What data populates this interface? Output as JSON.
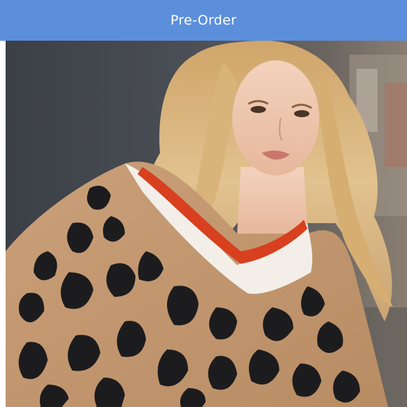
{
  "banner": {
    "label": "Pre-Order"
  },
  "product_photo": {
    "subject": "model-wearing-leopard-print-v-neck-sweater",
    "icon": "photo-image"
  },
  "colors": {
    "banner_bg": "#5b8fdb",
    "banner_text": "#ffffff",
    "sweater_base": "#c49a72",
    "leopard_spot": "#1c1c1e",
    "neck_trim_white": "#f5f1ea",
    "neck_trim_red": "#d8401f",
    "hair": "#d9b47a",
    "background_dark": "#3a3e45"
  }
}
